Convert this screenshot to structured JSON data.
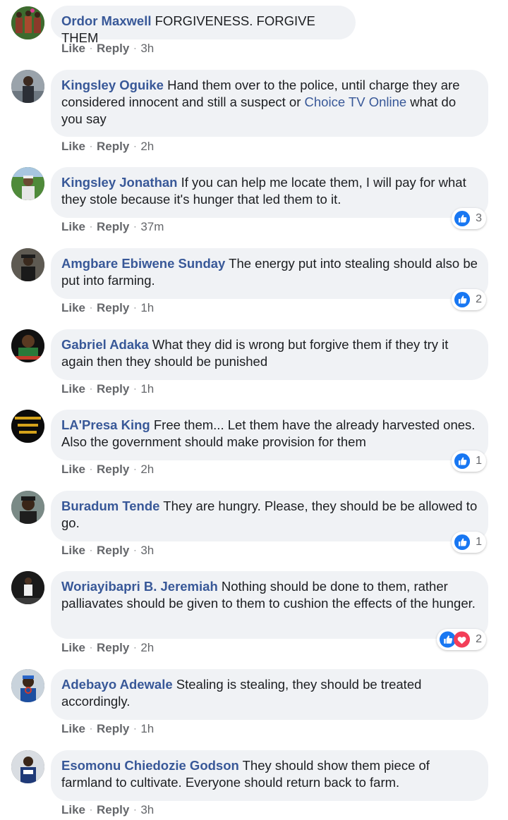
{
  "actions": {
    "like": "Like",
    "reply": "Reply",
    "separator": "·"
  },
  "colors": {
    "author": "#385898",
    "bubble": "#f0f2f5",
    "like_blue": "#1877f2",
    "love_red": "#f33e58"
  },
  "comments": [
    {
      "author": "Ordor Maxwell",
      "text": "FORGIVENESS. FORGIVE THEM",
      "time": "3h"
    },
    {
      "author": "Kingsley Oguike",
      "text_before": "Hand them over to the police, until charge they are considered innocent and still a suspect or ",
      "mention": "Choice TV Online",
      "text_after": " what do you say",
      "time": "2h"
    },
    {
      "author": "Kingsley Jonathan",
      "text": "If you can help me locate them, I will pay for what they stole because it's hunger that led them to it.",
      "time": "37m",
      "reactions": {
        "types": [
          "like-icon"
        ],
        "count": "3"
      }
    },
    {
      "author": "Amgbare Ebiwene Sunday",
      "text": "The energy put into stealing should also be put into farming.",
      "time": "1h",
      "reactions": {
        "types": [
          "like-icon"
        ],
        "count": "2"
      }
    },
    {
      "author": "Gabriel Adaka",
      "text": "What they did is wrong but forgive them if they try it again then they should be punished",
      "time": "1h"
    },
    {
      "author": "LA'Presa King",
      "text": "Free them... Let them have the already harvested ones. Also the government should make provision for them",
      "time": "2h",
      "reactions": {
        "types": [
          "like-icon"
        ],
        "count": "1"
      }
    },
    {
      "author": "Buradum Tende",
      "text": "They are hungry. Please, they should be be allowed to go.",
      "time": "3h",
      "reactions": {
        "types": [
          "like-icon"
        ],
        "count": "1"
      }
    },
    {
      "author": "Woriayibapri B. Jeremiah",
      "text": "Nothing should be done to them, rather palliavates should be given to them to cushion the effects of the hunger.",
      "time": "2h",
      "reactions": {
        "types": [
          "like-icon",
          "love-icon"
        ],
        "count": "2"
      }
    },
    {
      "author": "Adebayo Adewale",
      "text": "Stealing is stealing, they should be treated accordingly.",
      "time": "1h"
    },
    {
      "author": "Esomonu Chiedozie Godson",
      "text": "They should show them piece of farmland to cultivate. Everyone should return back to farm.",
      "time": "3h"
    }
  ]
}
